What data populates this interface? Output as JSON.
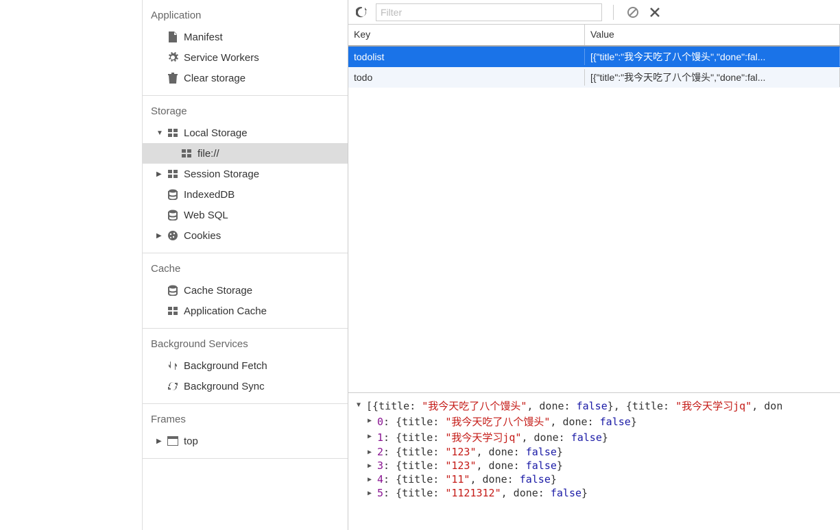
{
  "sidebar": {
    "sections": {
      "application": {
        "title": "Application",
        "items": [
          {
            "label": "Manifest",
            "icon": "file-icon"
          },
          {
            "label": "Service Workers",
            "icon": "gear-icon"
          },
          {
            "label": "Clear storage",
            "icon": "trash-icon"
          }
        ]
      },
      "storage": {
        "title": "Storage",
        "local_storage": {
          "label": "Local Storage",
          "child": "file://",
          "expanded": true
        },
        "session_storage": {
          "label": "Session Storage"
        },
        "indexeddb": {
          "label": "IndexedDB"
        },
        "websql": {
          "label": "Web SQL"
        },
        "cookies": {
          "label": "Cookies"
        }
      },
      "cache": {
        "title": "Cache",
        "items": [
          {
            "label": "Cache Storage",
            "icon": "db-icon"
          },
          {
            "label": "Application Cache",
            "icon": "grid-icon"
          }
        ]
      },
      "background": {
        "title": "Background Services",
        "items": [
          {
            "label": "Background Fetch",
            "icon": "fetch-icon"
          },
          {
            "label": "Background Sync",
            "icon": "sync-icon"
          }
        ]
      },
      "frames": {
        "title": "Frames",
        "top": {
          "label": "top"
        }
      }
    }
  },
  "toolbar": {
    "filter_placeholder": "Filter"
  },
  "table": {
    "headers": {
      "key": "Key",
      "value": "Value"
    },
    "rows": [
      {
        "key": "todolist",
        "value": "[{\"title\":\"我今天吃了八个馒头\",\"done\":fal...",
        "selected": true
      },
      {
        "key": "todo",
        "value": "[{\"title\":\"我今天吃了八个馒头\",\"done\":fal..."
      }
    ]
  },
  "console": {
    "summary_parts": {
      "p1": "[{title: ",
      "s1": "\"我今天吃了八个馒头\"",
      "p2": ", done: ",
      "b1": "false",
      "p3": "}, {title: ",
      "s2": "\"我今天学习jq\"",
      "p4": ", don"
    },
    "items": [
      {
        "idx": "0",
        "title": "\"我今天吃了八个馒头\"",
        "done": "false"
      },
      {
        "idx": "1",
        "title": "\"我今天学习jq\"",
        "done": "false"
      },
      {
        "idx": "2",
        "title": "\"123\"",
        "done": "false"
      },
      {
        "idx": "3",
        "title": "\"123\"",
        "done": "false"
      },
      {
        "idx": "4",
        "title": "\"11\"",
        "done": "false"
      },
      {
        "idx": "5",
        "title": "\"1121312\"",
        "done": "false"
      }
    ]
  }
}
